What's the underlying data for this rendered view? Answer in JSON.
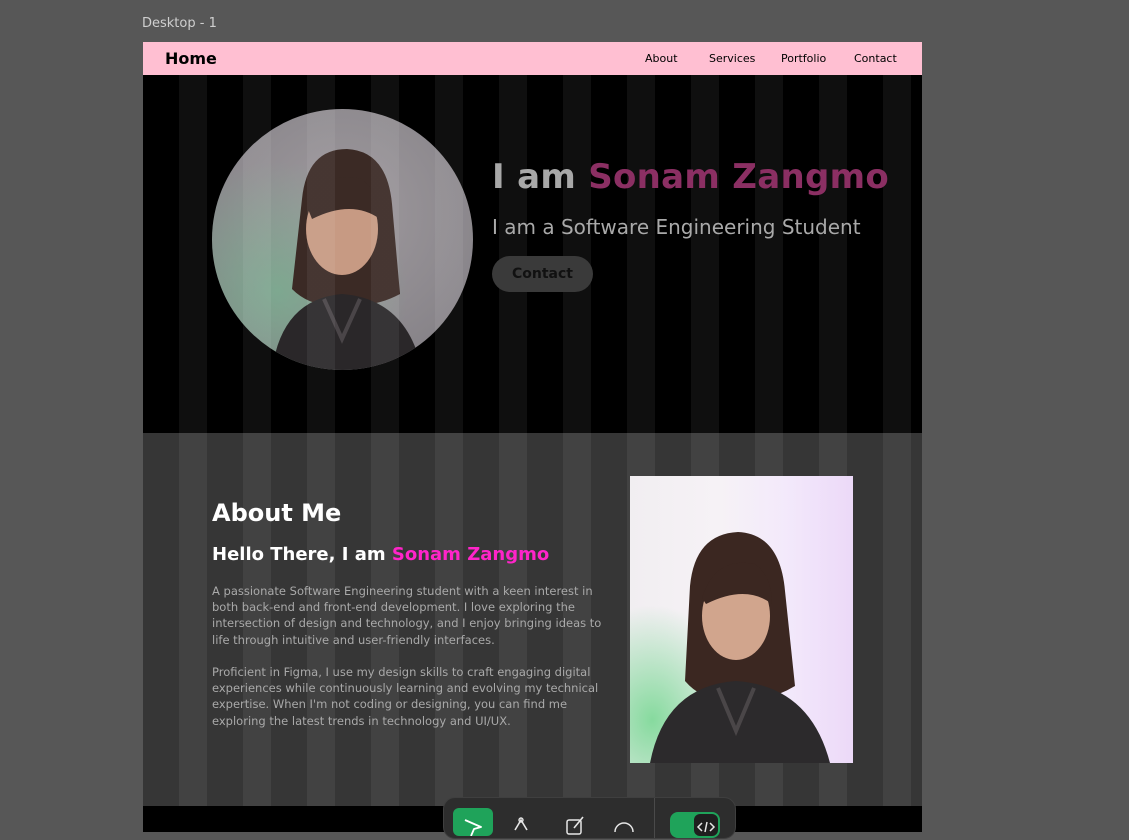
{
  "canvas": {
    "frame_label": "Desktop - 1"
  },
  "nav": {
    "home": "Home",
    "links": [
      "About",
      "Services",
      "Portfolio",
      "Contact"
    ]
  },
  "hero": {
    "title_prefix": "I am ",
    "name": "Sonam Zangmo",
    "subtitle": "I am a Software Engineering Student",
    "cta": "Contact"
  },
  "about": {
    "heading": "About Me",
    "hello_prefix": "Hello There, I am ",
    "hello_name": "Sonam Zangmo",
    "p1": "A passionate Software Engineering student with a keen interest in both back-end and front-end development. I love exploring the intersection of design and technology, and I enjoy bringing ideas to life through intuitive and user-friendly interfaces.",
    "p2": "Proficient in Figma, I use my design skills to craft engaging digital experiences while continuously learning and evolving my technical expertise. When I'm not coding or designing, you can find me exploring the latest trends in technology and UI/UX."
  },
  "toolbar": {
    "tools": [
      "move-icon",
      "pen-icon",
      "pencil-icon",
      "comment-icon"
    ],
    "dev_mode_toggle": "code-icon"
  },
  "colors": {
    "nav_bg": "#ffbfd2",
    "hero_name": "#8b2f63",
    "about_highlight": "#ff24c9",
    "toolbar_active": "#1fa35a"
  }
}
